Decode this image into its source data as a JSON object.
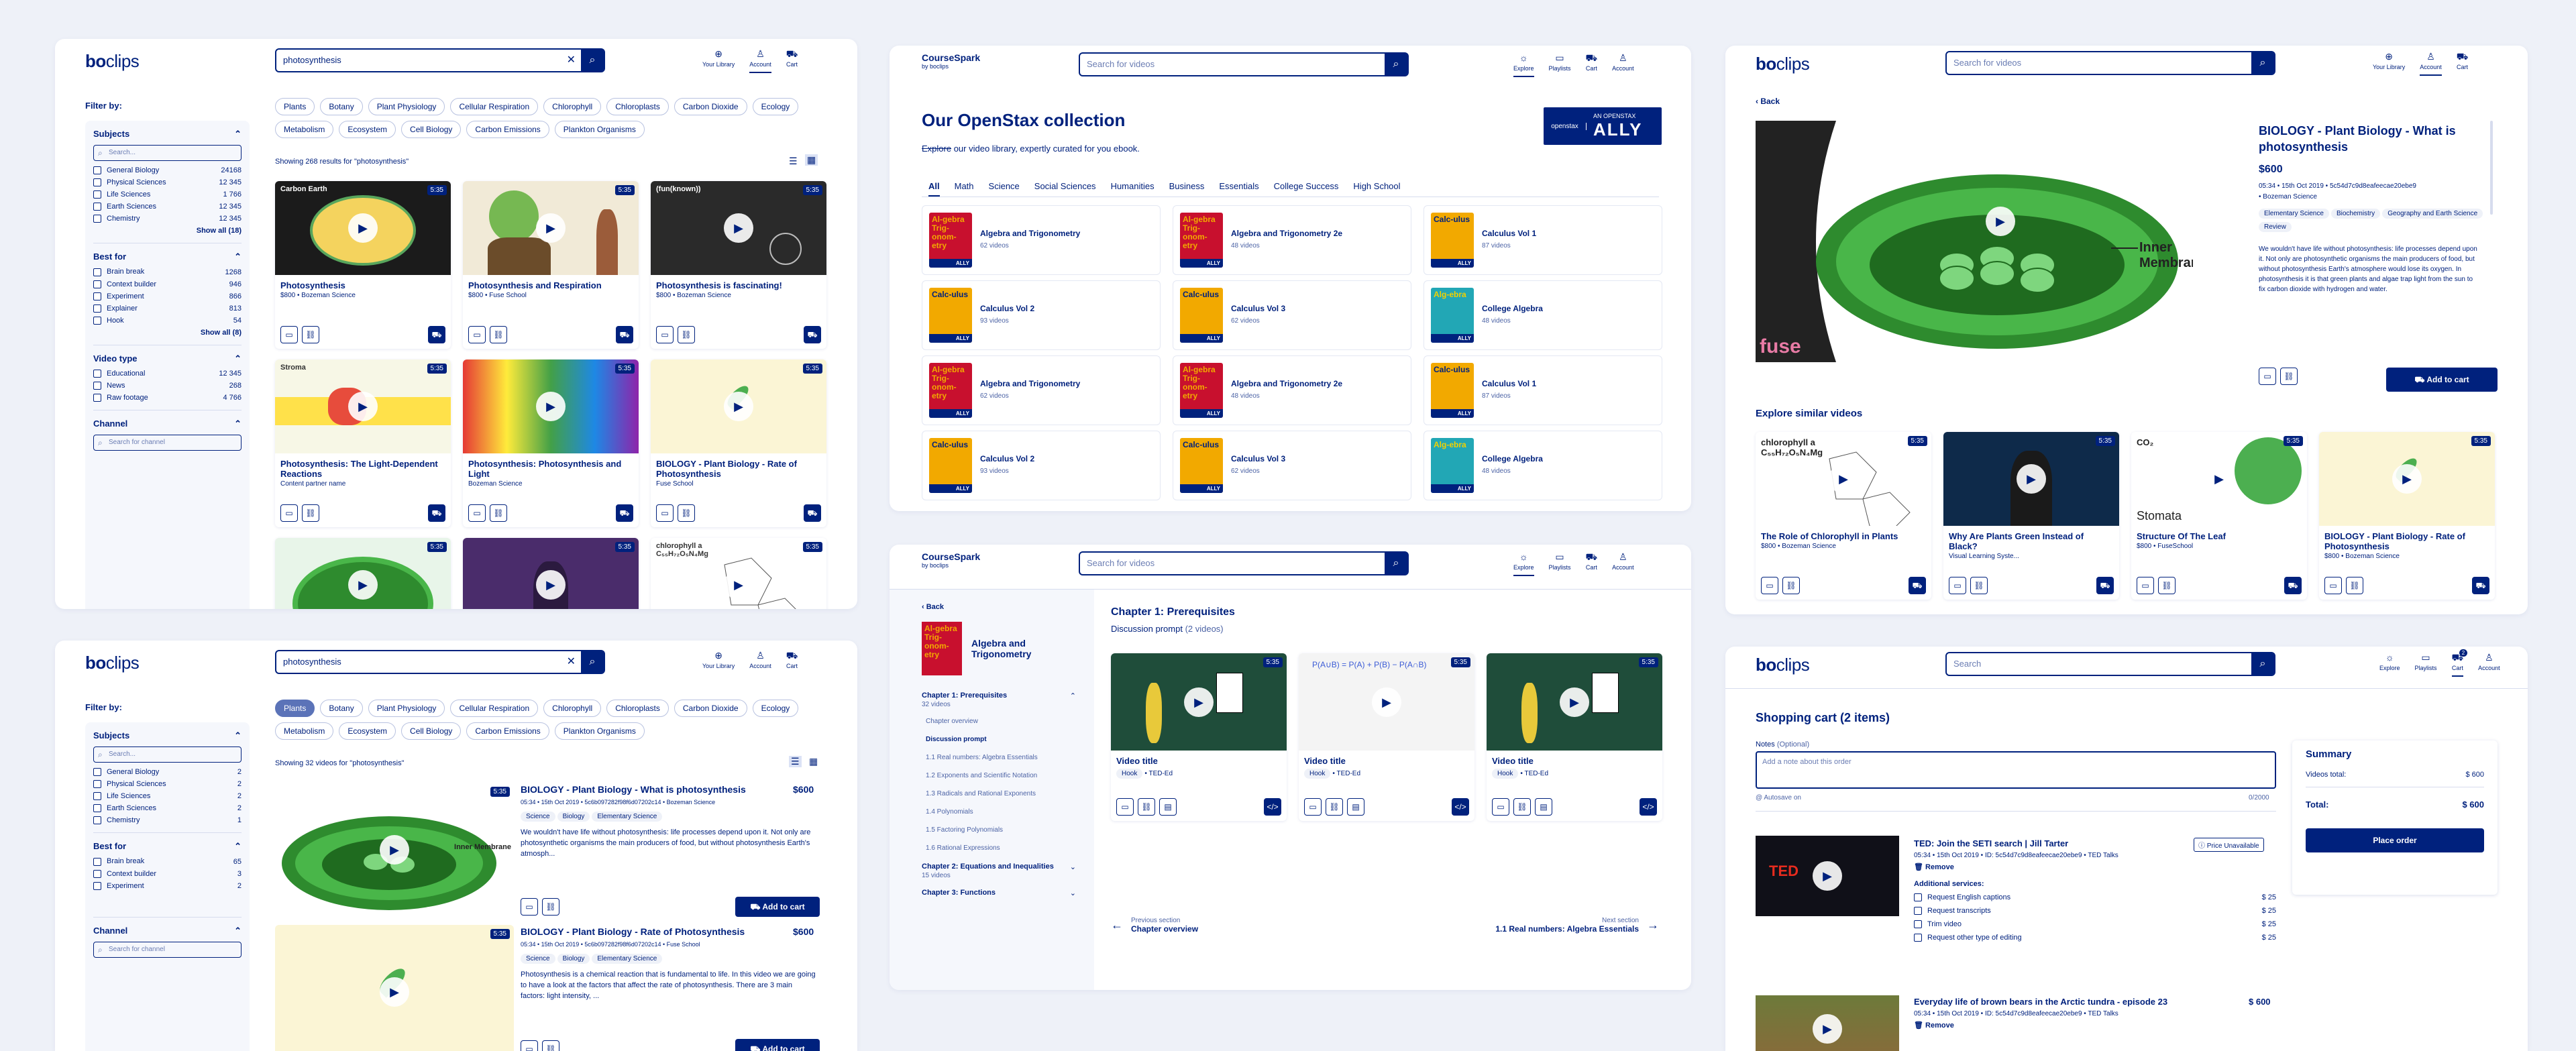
{
  "colors": {
    "navy": "#00217d",
    "bg": "#eef1f8",
    "chip_active": "#5b73b8"
  },
  "nav": {
    "library": "Your Library",
    "account": "Account",
    "cart": "Cart",
    "explore": "Explore",
    "playlists": "Playlists"
  },
  "brand": {
    "logo_bold": "bo",
    "logo_light": "clips",
    "cs_title": "CourseSpark",
    "cs_by": "by boclips"
  },
  "p1": {
    "search_value": "photosynthesis",
    "filter_by": "Filter by:",
    "subjects_title": "Subjects",
    "subjects_search": "Search...",
    "subjects": [
      {
        "l": "General Biology",
        "c": "24168"
      },
      {
        "l": "Physical Sciences",
        "c": "12 345"
      },
      {
        "l": "Life Sciences",
        "c": "1 766"
      },
      {
        "l": "Earth Sciences",
        "c": "12 345"
      },
      {
        "l": "Chemistry",
        "c": "12 345"
      }
    ],
    "subjects_showall": "Show all (18)",
    "bestfor_title": "Best for",
    "bestfor": [
      {
        "l": "Brain break",
        "c": "1268"
      },
      {
        "l": "Context builder",
        "c": "946"
      },
      {
        "l": "Experiment",
        "c": "866"
      },
      {
        "l": "Explainer",
        "c": "813"
      },
      {
        "l": "Hook",
        "c": "54"
      }
    ],
    "bestfor_showall": "Show all (8)",
    "vtype_title": "Video type",
    "vtype": [
      {
        "l": "Educational",
        "c": "12 345"
      },
      {
        "l": "News",
        "c": "268"
      },
      {
        "l": "Raw footage",
        "c": "4 766"
      }
    ],
    "channel_title": "Channel",
    "channel_search": "Search for channel",
    "chips": [
      "Plants",
      "Botany",
      "Plant Physiology",
      "Cellular Respiration",
      "Chlorophyll",
      "Chloroplasts",
      "Carbon Dioxide",
      "Ecology",
      "Metabolism",
      "Ecosystem",
      "Cell Biology",
      "Carbon Emissions",
      "Plankton Organisms"
    ],
    "results": "Showing 268 results for \"photosynthesis\"",
    "cards": [
      {
        "t": "Photosynthesis",
        "s": "$800 • Bozeman Science",
        "d": "5:35"
      },
      {
        "t": "Photosynthesis and Respiration",
        "s": "$800 • Fuse School",
        "d": "5:35"
      },
      {
        "t": "Photosynthesis is fascinating!",
        "s": "$800 • Bozeman Science",
        "d": "5:35"
      },
      {
        "t": "Photosynthesis: The Light-Dependent Reactions",
        "s": "Content partner name",
        "d": "5:35"
      },
      {
        "t": "Photosynthesis: Photosynthesis and Light",
        "s": "Bozeman Science",
        "d": "5:35"
      },
      {
        "t": "BIOLOGY - Plant Biology - Rate of Photosynthesis",
        "s": "Fuse School",
        "d": "5:35"
      },
      {
        "t": "",
        "s": "",
        "d": "5:35"
      },
      {
        "t": "",
        "s": "",
        "d": "5:35"
      },
      {
        "t": "",
        "s": "",
        "d": "5:35"
      }
    ],
    "thumb_texts": {
      "carbon": "Carbon Earth",
      "stroma": "Stroma",
      "chloro": "chlorophyll a\nC₅₅H₇₂O₅N₄Mg",
      "fun": "(fun(known))"
    }
  },
  "p2": {
    "search_value": "photosynthesis",
    "filter_by": "Filter by:",
    "subjects_title": "Subjects",
    "subjects_search": "Search...",
    "subjects": [
      {
        "l": "General Biology",
        "c": "2"
      },
      {
        "l": "Physical Sciences",
        "c": "2"
      },
      {
        "l": "Life Sciences",
        "c": "2"
      },
      {
        "l": "Earth Sciences",
        "c": "2"
      },
      {
        "l": "Chemistry",
        "c": "1"
      }
    ],
    "bestfor_title": "Best for",
    "bestfor": [
      {
        "l": "Brain break",
        "c": "65"
      },
      {
        "l": "Context builder",
        "c": "3"
      },
      {
        "l": "Experiment",
        "c": "2"
      }
    ],
    "channel_title": "Channel",
    "channel_search": "Search for channel",
    "chips": [
      "Plants",
      "Botany",
      "Plant Physiology",
      "Cellular Respiration",
      "Chlorophyll",
      "Chloroplasts",
      "Carbon Dioxide",
      "Ecology",
      "Metabolism",
      "Ecosystem",
      "Cell Biology",
      "Carbon Emissions",
      "Plankton Organisms"
    ],
    "results": "Showing 32 videos for \"photosynthesis\"",
    "list": [
      {
        "t": "BIOLOGY - Plant Biology - What is photosynthesis",
        "p": "$600",
        "meta": "05:34 • 15th Oct 2019 • 5c6b097282f98f6d07202c14 • Bozeman Science",
        "tags": [
          "Science",
          "Biology",
          "Elementary Science"
        ],
        "desc": "We wouldn't have life without photosynthesis: life processes depend upon it. Not only are photosynthetic organisms the main producers of food, but without photosynthesis Earth's atmosph...",
        "cart": "Add to cart",
        "d": "5:35",
        "lbl": "Inner Membrane"
      },
      {
        "t": "BIOLOGY - Plant Biology - Rate of Photosynthesis",
        "p": "$600",
        "meta": "05:34 • 15th Oct 2019 • 5c6b097282f98f6d07202c14 • Fuse School",
        "tags": [
          "Science",
          "Biology",
          "Elementary Science"
        ],
        "desc": "Photosynthesis is a chemical reaction that is fundamental to life. In this video we are going to have a look at the factors that affect the rate of photosynthesis. There are 3 main factors: light intensity, ...",
        "cart": "Add to cart",
        "d": "5:35"
      }
    ]
  },
  "p3": {
    "search_ph": "Search for videos",
    "title": "Our OpenStax collection",
    "sub_strike": "Explore",
    "sub_rest": " our video library, expertly curated for you ebook.",
    "badge_top": "AN OPENSTAX",
    "badge_main": "ALLY",
    "badge_os": "openstax",
    "tabs": [
      "All",
      "Math",
      "Science",
      "Social Sciences",
      "Humanities",
      "Business",
      "Essentials",
      "College Success",
      "High School"
    ],
    "books": [
      {
        "t": "Algebra and Trigonometry",
        "c": "62 videos",
        "k": "alg"
      },
      {
        "t": "Algebra and Trigonometry 2e",
        "c": "48 videos",
        "k": "alg"
      },
      {
        "t": "Calculus Vol 1",
        "c": "87 videos",
        "k": "calc"
      },
      {
        "t": "Calculus Vol 2",
        "c": "93 videos",
        "k": "calc"
      },
      {
        "t": "Calculus Vol 3",
        "c": "62 videos",
        "k": "calc"
      },
      {
        "t": "College Algebra",
        "c": "48 videos",
        "k": "col"
      },
      {
        "t": "Algebra and Trigonometry",
        "c": "62 videos",
        "k": "alg"
      },
      {
        "t": "Algebra and Trigonometry 2e",
        "c": "48 videos",
        "k": "alg"
      },
      {
        "t": "Calculus Vol 1",
        "c": "87 videos",
        "k": "calc"
      },
      {
        "t": "Calculus Vol 2",
        "c": "93 videos",
        "k": "calc"
      },
      {
        "t": "Calculus Vol 3",
        "c": "62 videos",
        "k": "calc"
      },
      {
        "t": "College Algebra",
        "c": "48 videos",
        "k": "col"
      }
    ],
    "cover_alg": "Al-gebra Trig-onom-etry",
    "cover_calc": "Calc-ulus",
    "cover_col": "Alg-ebra",
    "cover_ally": "ALLY"
  },
  "p4": {
    "search_ph": "Search for videos",
    "back": "Back",
    "book": "Algebra and Trigonometry",
    "chapters": [
      {
        "t": "Chapter 1: Prerequisites",
        "c": "32 videos"
      },
      {
        "t": "Chapter 2: Equations and Inequalities",
        "c": "15 videos"
      },
      {
        "t": "Chapter 3: Functions",
        "c": ""
      }
    ],
    "sections": [
      "Chapter overview",
      "Discussion prompt",
      "1.1 Real numbers: Algebra Essentials",
      "1.2 Exponents and Scientific Notation",
      "1.3 Radicals and Rational Exponents",
      "1.4 Polynomials",
      "1.5 Factoring Polynomials",
      "1.6 Rational Expressions"
    ],
    "heading": "Chapter 1: Prerequisites",
    "prompt": "Discussion prompt",
    "prompt_count": "(2 videos)",
    "videos": [
      {
        "t": "Video title",
        "tag": "Hook",
        "src": "• TED-Ed",
        "d": "5:35"
      },
      {
        "t": "Video title",
        "tag": "Hook",
        "src": "• TED-Ed",
        "d": "5:35"
      },
      {
        "t": "Video title",
        "tag": "Hook",
        "src": "• TED-Ed",
        "d": "5:35"
      }
    ],
    "formula": "P(A∪B) = P(A) + P(B) − P(A∩B)",
    "prev_lbl": "Previous section",
    "prev": "Chapter overview",
    "next_lbl": "Next section",
    "next": "1.1 Real numbers: Algebra Essentials"
  },
  "p5": {
    "search_ph": "Search for videos",
    "back": "Back",
    "title": "BIOLOGY - Plant Biology - What is photosynthesis",
    "price": "$600",
    "meta": "05:34 • 15th Oct 2019 • 5c54d7c9d8eafeecae20ebe9",
    "channel": "• Bozeman Science",
    "tags": [
      "Elementary Science",
      "Biochemistry",
      "Geography and Earth Science",
      "Review"
    ],
    "desc": "We wouldn't have life without photosynthesis: life processes depend upon it. Not only are photosynthetic organisms the main producers of food, but without photosynthesis Earth's atmosphere would lose its oxygen. In photosynthesis it is that green plants and algae trap light from the sun to fix carbon dioxide with hydrogen and water.",
    "cart": "Add to cart",
    "lbl": "Inner Membrane",
    "fuse": "fuse",
    "similar": "Explore similar videos",
    "cards": [
      {
        "t": "The Role of Chlorophyll in Plants",
        "s": "$800 • Bozeman Science",
        "d": "5:35"
      },
      {
        "t": "Why Are Plants Green Instead of Black?",
        "s": "Visual Learning Syste...",
        "d": "5:35"
      },
      {
        "t": "Structure Of The Leaf",
        "s": "$800 • FuseSchool",
        "d": "5:35"
      },
      {
        "t": "BIOLOGY - Plant Biology - Rate of Photosynthesis",
        "s": "$800 • Bozeman Science",
        "d": "5:35"
      }
    ],
    "chloro": "chlorophyll a\nC₅₅H₇₂O₅N₄Mg",
    "stomata": "Stomata",
    "co2": "CO₂"
  },
  "p6": {
    "search_ph": "Search",
    "cart_count": "2",
    "title": "Shopping cart (2 items)",
    "notes_lbl": "Notes",
    "notes_opt": "(Optional)",
    "notes_ph": "Add a note about this order",
    "autosave": "@ Autosave on",
    "counter": "0/2000",
    "items": [
      {
        "t": "TED: Join the SETI search | Jill Tarter",
        "price_note": "Price Unavailable",
        "meta": "05:34 • 15th Oct 2019 • ID: 5c54d7c9d8eafeecae20ebe9 • TED Talks",
        "remove": "Remove"
      },
      {
        "t": "Everyday life of brown bears in the Arctic tundra - episode 23",
        "price": "$ 600",
        "meta": "05:34 • 15th Oct 2019 • ID: 5c54d7c9d8eafeecae20ebe9 • TED Talks",
        "remove": "Remove"
      }
    ],
    "addl": "Additional services:",
    "services": [
      {
        "l": "Request English captions",
        "p": "$ 25"
      },
      {
        "l": "Request transcripts",
        "p": "$ 25"
      },
      {
        "l": "Trim video",
        "p": "$ 25"
      },
      {
        "l": "Request other type of editing",
        "p": "$ 25"
      }
    ],
    "summary": "Summary",
    "vtotal_l": "Videos total:",
    "vtotal": "$ 600",
    "total_l": "Total:",
    "total": "$ 600",
    "place": "Place order",
    "ted": "TED"
  }
}
